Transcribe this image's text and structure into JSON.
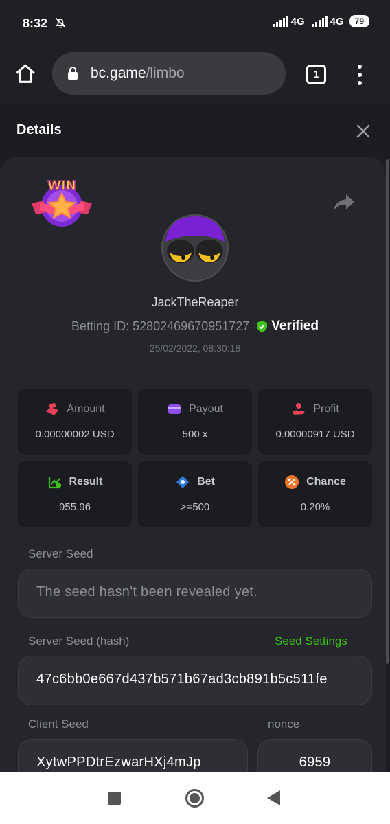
{
  "status_bar": {
    "time": "8:32",
    "network_1": "4G",
    "network_2": "4G",
    "battery": "79",
    "icons": [
      "bell-off-icon",
      "signal-icon",
      "battery-icon"
    ]
  },
  "browser": {
    "url_domain": "bc.game",
    "url_path": "/limbo",
    "tab_count": "1",
    "icons": [
      "home-icon",
      "lock-icon",
      "tabs-icon",
      "more-vertical-icon"
    ]
  },
  "details": {
    "title": "Details",
    "close_icon": "close-icon"
  },
  "bet": {
    "badge_text": "WIN",
    "username": "JackTheReaper",
    "betting_id_label": "Betting ID:",
    "betting_id": "52802469670951727",
    "verified_label": "Verified",
    "date": "25/02/2022, 08:30:18"
  },
  "stats": [
    {
      "label": "Amount",
      "value": "0.00000002 USD",
      "icon": "money-hand-icon",
      "color": "#e9415a"
    },
    {
      "label": "Payout",
      "value": "500 x",
      "icon": "wallet-card-icon",
      "color": "#8b4dea"
    },
    {
      "label": "Profit",
      "value": "0.00000917 USD",
      "icon": "coin-hand-icon",
      "color": "#e9415a"
    },
    {
      "label": "Result",
      "value": "955.96",
      "icon": "chart-check-icon",
      "color": "#3bc117"
    },
    {
      "label": "Bet",
      "value": ">=500",
      "icon": "tag-icon",
      "color": "#2f7de1"
    },
    {
      "label": "Chance",
      "value": "0.20%",
      "icon": "percent-icon",
      "color": "#f0762a"
    }
  ],
  "seeds": {
    "server_seed_label": "Server Seed",
    "server_seed_value": "The seed hasn't been revealed yet.",
    "server_hash_label": "Server Seed (hash)",
    "seed_settings_label": "Seed Settings",
    "server_hash_value": "47c6bb0e667d437b571b67ad3cb891b5c511fe",
    "client_seed_label": "Client Seed",
    "client_seed_value": "XytwPPDtrEzwarHXj4mJp",
    "nonce_label": "nonce",
    "nonce_value": "6959"
  },
  "colors": {
    "accent_green": "#3bc117",
    "background": "#1b1d22",
    "card": "#24262b"
  }
}
